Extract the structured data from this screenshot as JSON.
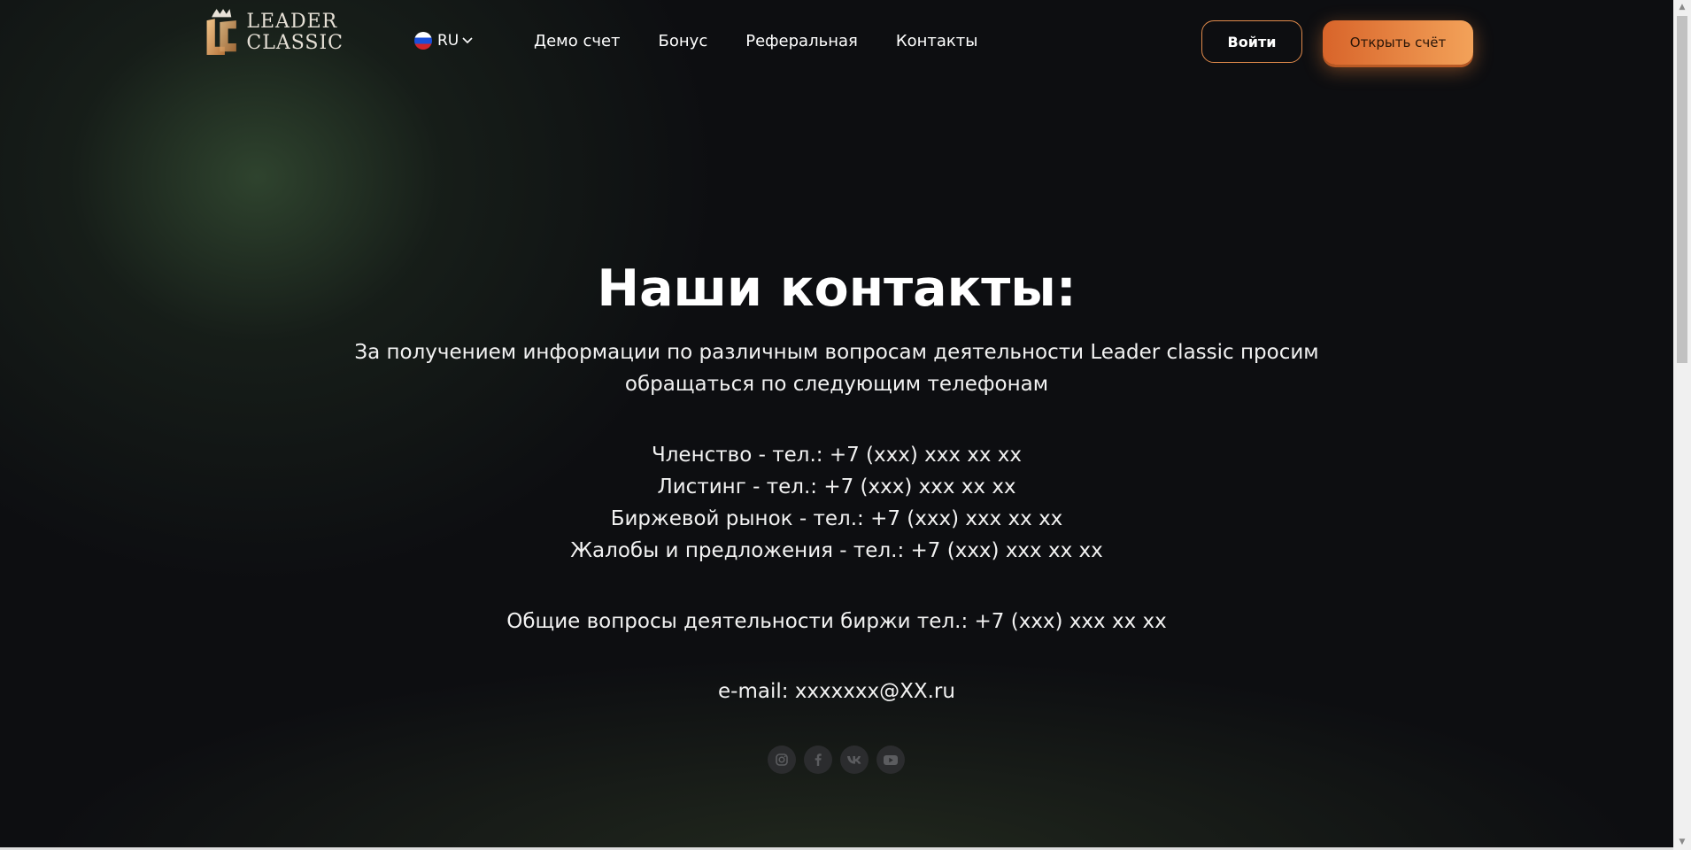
{
  "header": {
    "logo_text_line1": "LEADER",
    "logo_text_line2": "CLASSIC",
    "language": "RU",
    "nav": [
      "Демо счет",
      "Бонус",
      "Реферальная",
      "Контакты"
    ],
    "login_label": "Войти",
    "open_account_label": "Открыть счёт"
  },
  "main": {
    "title": "Наши контакты:",
    "intro_line1": "За получением информации по различным вопросам деятельности Leader classic просим",
    "intro_line2": "обращаться по следующим телефонам",
    "phones": [
      "Членство - тел.: +7 (xxx) xxx xx xx",
      "Листинг - тел.: +7 (xxx) xxx xx xx",
      "Биржевой рынок - тел.: +7 (xxx) xxx xx xx",
      "Жалобы и предложения - тел.: +7 (xxx) xxx xx xx"
    ],
    "general": "Общие вопросы деятельности биржи тел.: +7 (xxx) xxx xx xx",
    "email": "e-mail: xxxxxxx@XX.ru"
  },
  "socials": [
    "instagram-icon",
    "facebook-icon",
    "vk-icon",
    "youtube-icon"
  ],
  "colors": {
    "background": "#0d0e11",
    "accent_orange": "#e8833c",
    "accent_orange_light": "#f3a259",
    "social_bg": "#2b2c2e"
  }
}
